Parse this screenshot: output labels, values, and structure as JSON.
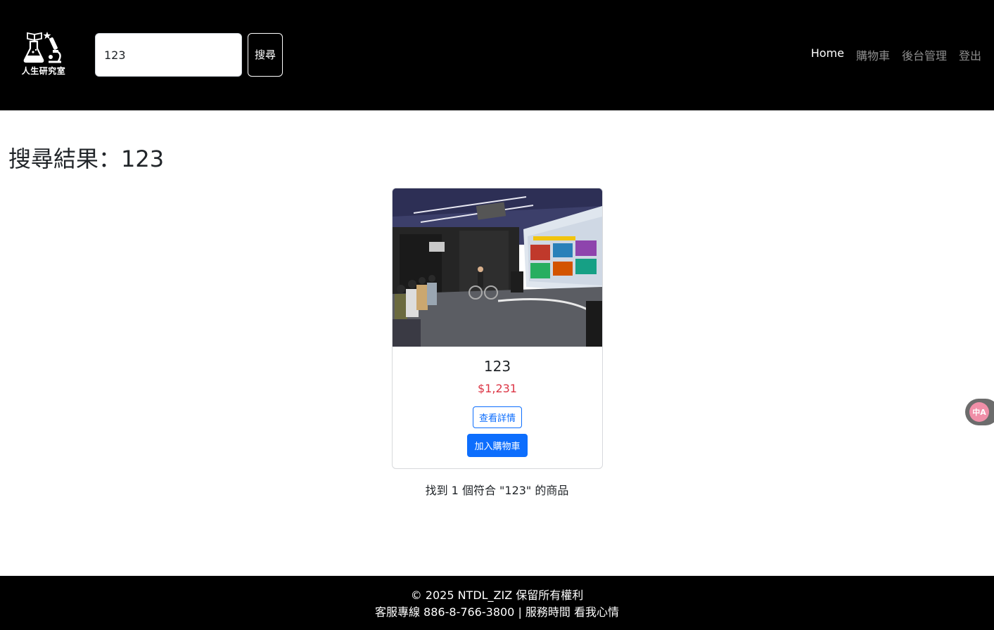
{
  "header": {
    "logo_text": "人生研究室",
    "search": {
      "value": "123",
      "placeholder": ""
    },
    "search_button_label": "搜尋",
    "nav": [
      {
        "label": "Home",
        "active": true
      },
      {
        "label": "購物車",
        "active": false
      },
      {
        "label": "後台管理",
        "active": false
      },
      {
        "label": "登出",
        "active": false
      }
    ]
  },
  "main": {
    "title": "搜尋結果：123",
    "product": {
      "name": "123",
      "price": "$1,231",
      "detail_button": "查看詳情",
      "add_to_cart_button": "加入購物車"
    },
    "result_text": "找到 1 個符合 \"123\" 的商品"
  },
  "translate_widget": {
    "icon": "translate-icon",
    "label": "中A"
  },
  "footer": {
    "line1": "© 2025 NTDL_ZIZ 保留所有權利",
    "line2": "客服專線 886-8-766-3800 | 服務時間 看我心情"
  },
  "colors": {
    "header_bg": "#000000",
    "primary": "#0d6efd",
    "price": "#dc3545"
  }
}
